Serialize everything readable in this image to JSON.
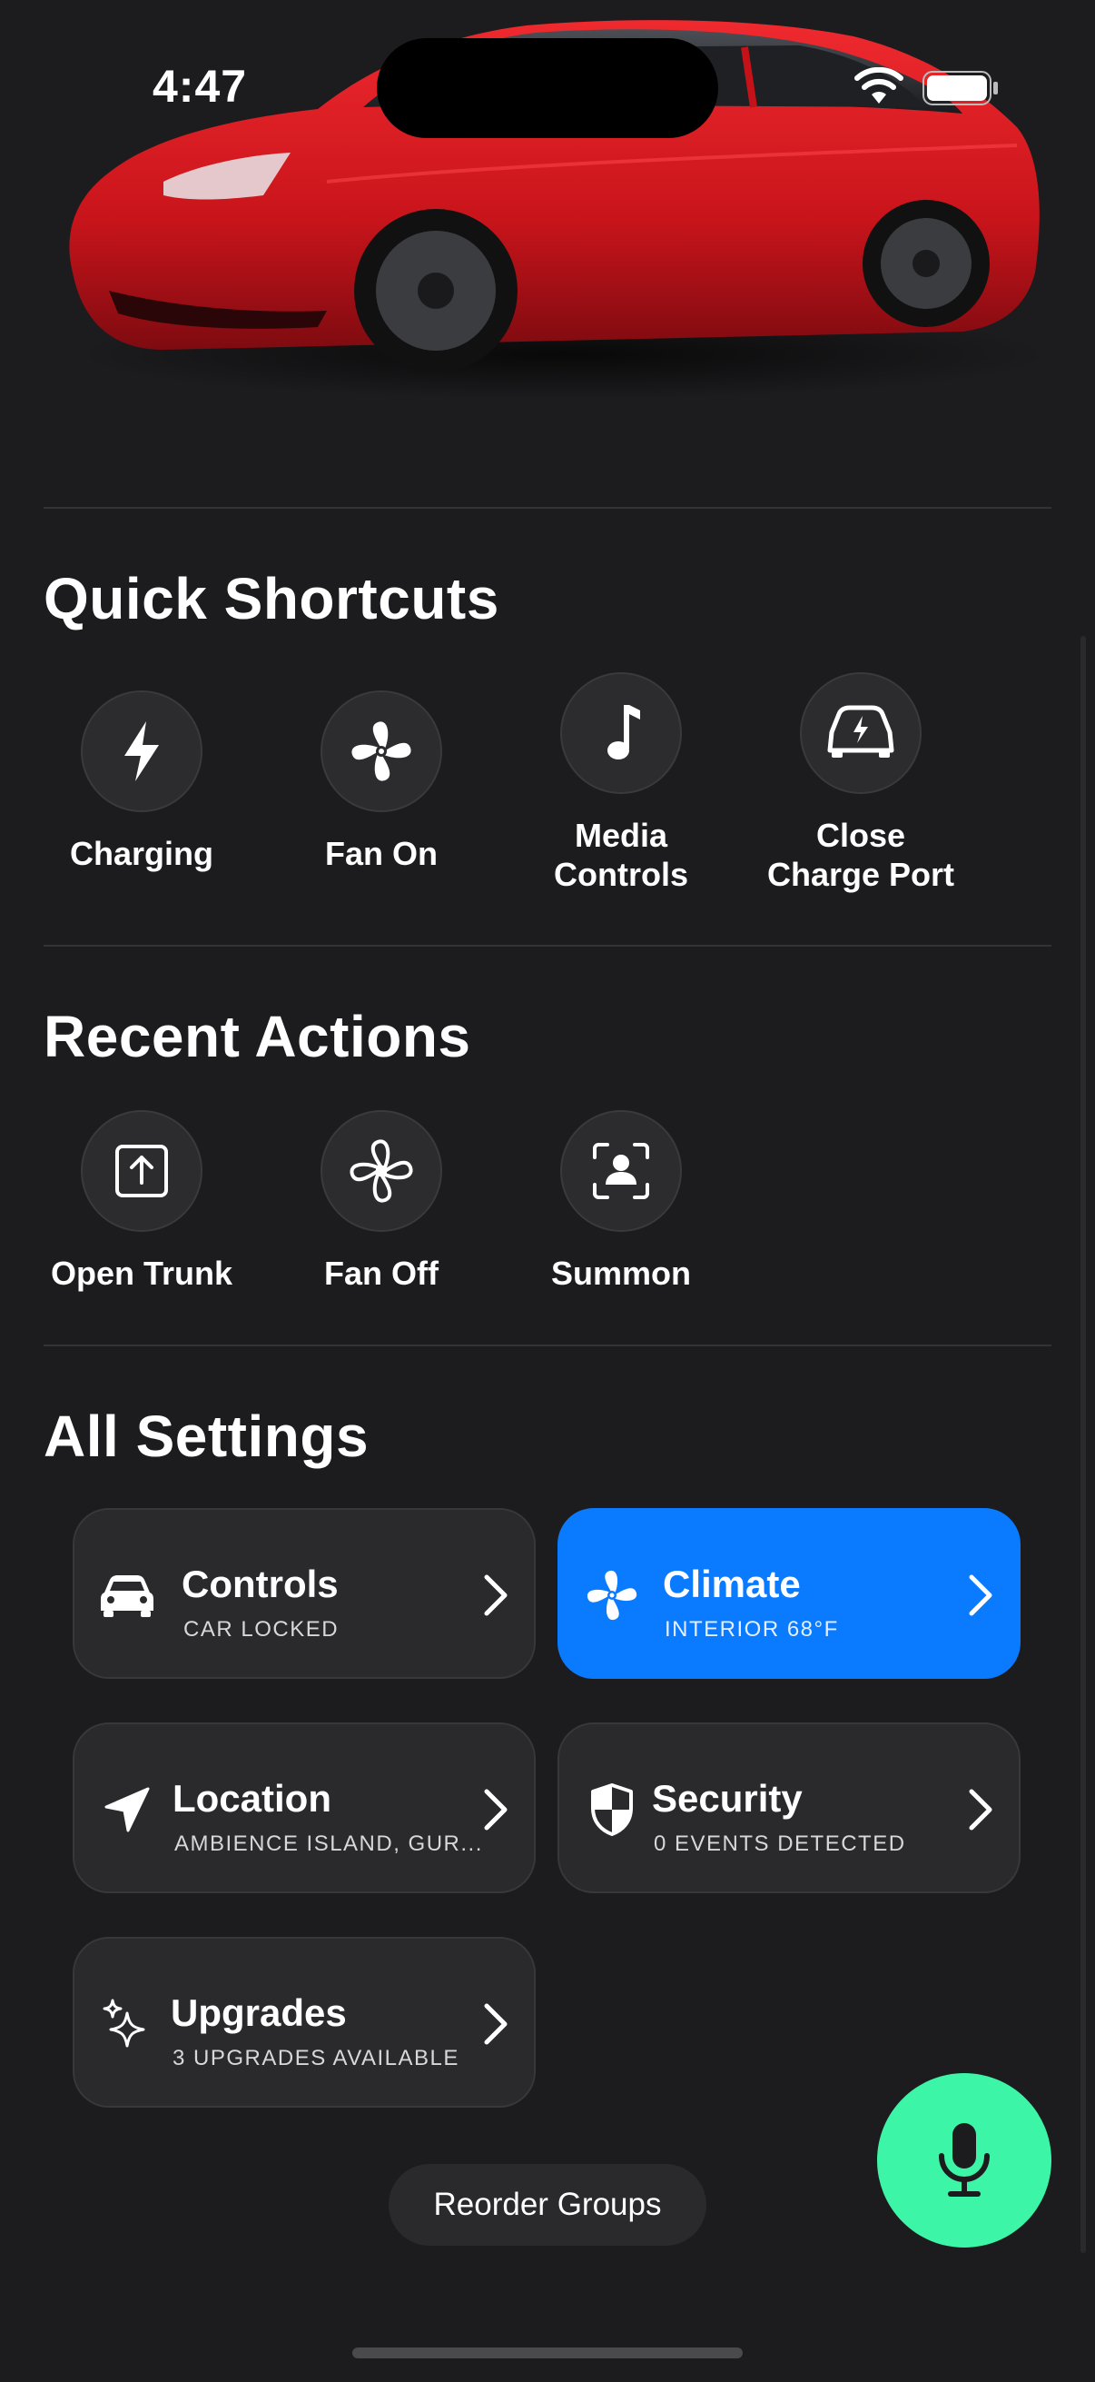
{
  "status_bar": {
    "time": "4:47"
  },
  "sections": {
    "quick_shortcuts_title": "Quick Shortcuts",
    "recent_actions_title": "Recent Actions",
    "all_settings_title": "All Settings"
  },
  "quick_shortcuts": [
    {
      "label": "Charging",
      "icon": "lightning-bolt-icon"
    },
    {
      "label": "Fan On",
      "icon": "fan-filled-icon"
    },
    {
      "label": "Media\nControls",
      "icon": "music-note-icon"
    },
    {
      "label": "Close\nCharge Port",
      "icon": "car-charge-icon"
    }
  ],
  "recent_actions": [
    {
      "label": "Open Trunk",
      "icon": "trunk-open-icon"
    },
    {
      "label": "Fan Off",
      "icon": "fan-outline-icon"
    },
    {
      "label": "Summon",
      "icon": "summon-icon"
    }
  ],
  "settings": [
    {
      "title": "Controls",
      "subtitle": "CAR LOCKED",
      "icon": "car-icon",
      "active": false
    },
    {
      "title": "Climate",
      "subtitle": "INTERIOR 68°F",
      "icon": "fan-icon",
      "active": true
    },
    {
      "title": "Location",
      "subtitle": "AMBIENCE ISLAND, GUR...",
      "icon": "location-arrow-icon",
      "active": false
    },
    {
      "title": "Security",
      "subtitle": "0 EVENTS DETECTED",
      "icon": "shield-icon",
      "active": false
    },
    {
      "title": "Upgrades",
      "subtitle": "3 UPGRADES AVAILABLE",
      "icon": "sparkles-icon",
      "active": false
    }
  ],
  "reorder_label": "Reorder Groups",
  "colors": {
    "background": "#1c1c1e",
    "accent": "#0a7aff",
    "mic": "#3cf5a6",
    "car": "#d8141c"
  }
}
